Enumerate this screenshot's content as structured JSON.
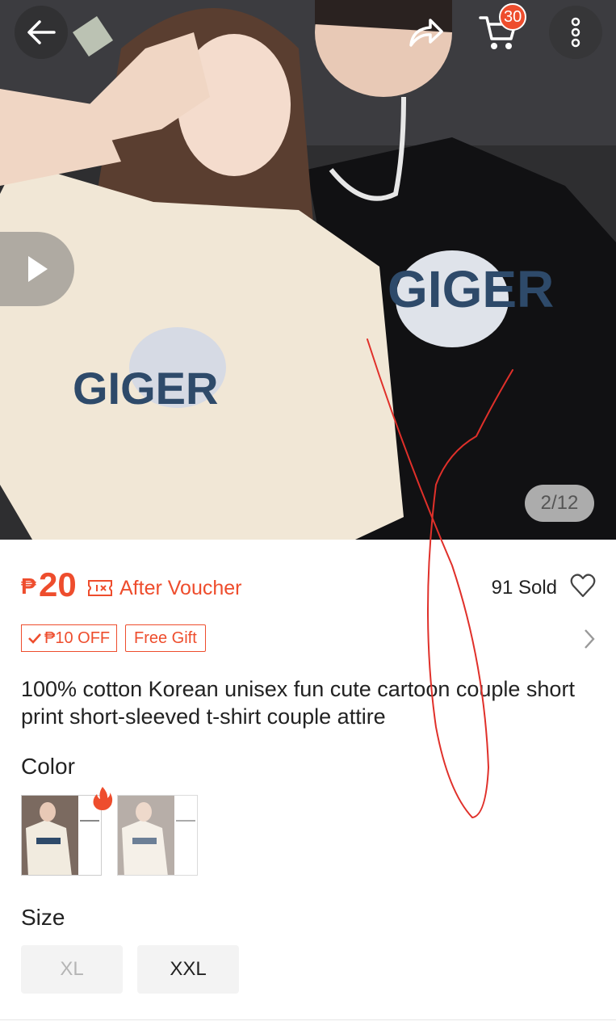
{
  "gallery": {
    "counter": "2/12",
    "cart_count": "30",
    "shirt_print_text": "GIGER"
  },
  "price": {
    "currency": "₱",
    "amount": "20",
    "after_voucher_label": "After Voucher",
    "sold_label": "91 Sold"
  },
  "tags": {
    "discount": "₱10 OFF",
    "gift": "Free Gift"
  },
  "product": {
    "title": "100% cotton Korean unisex fun cute cartoon couple short print short-sleeved t-shirt couple attire"
  },
  "color_section": {
    "label": "Color"
  },
  "size_section": {
    "label": "Size",
    "options": [
      "XL",
      "XXL"
    ]
  },
  "colors": {
    "accent": "#ee4d2d"
  }
}
